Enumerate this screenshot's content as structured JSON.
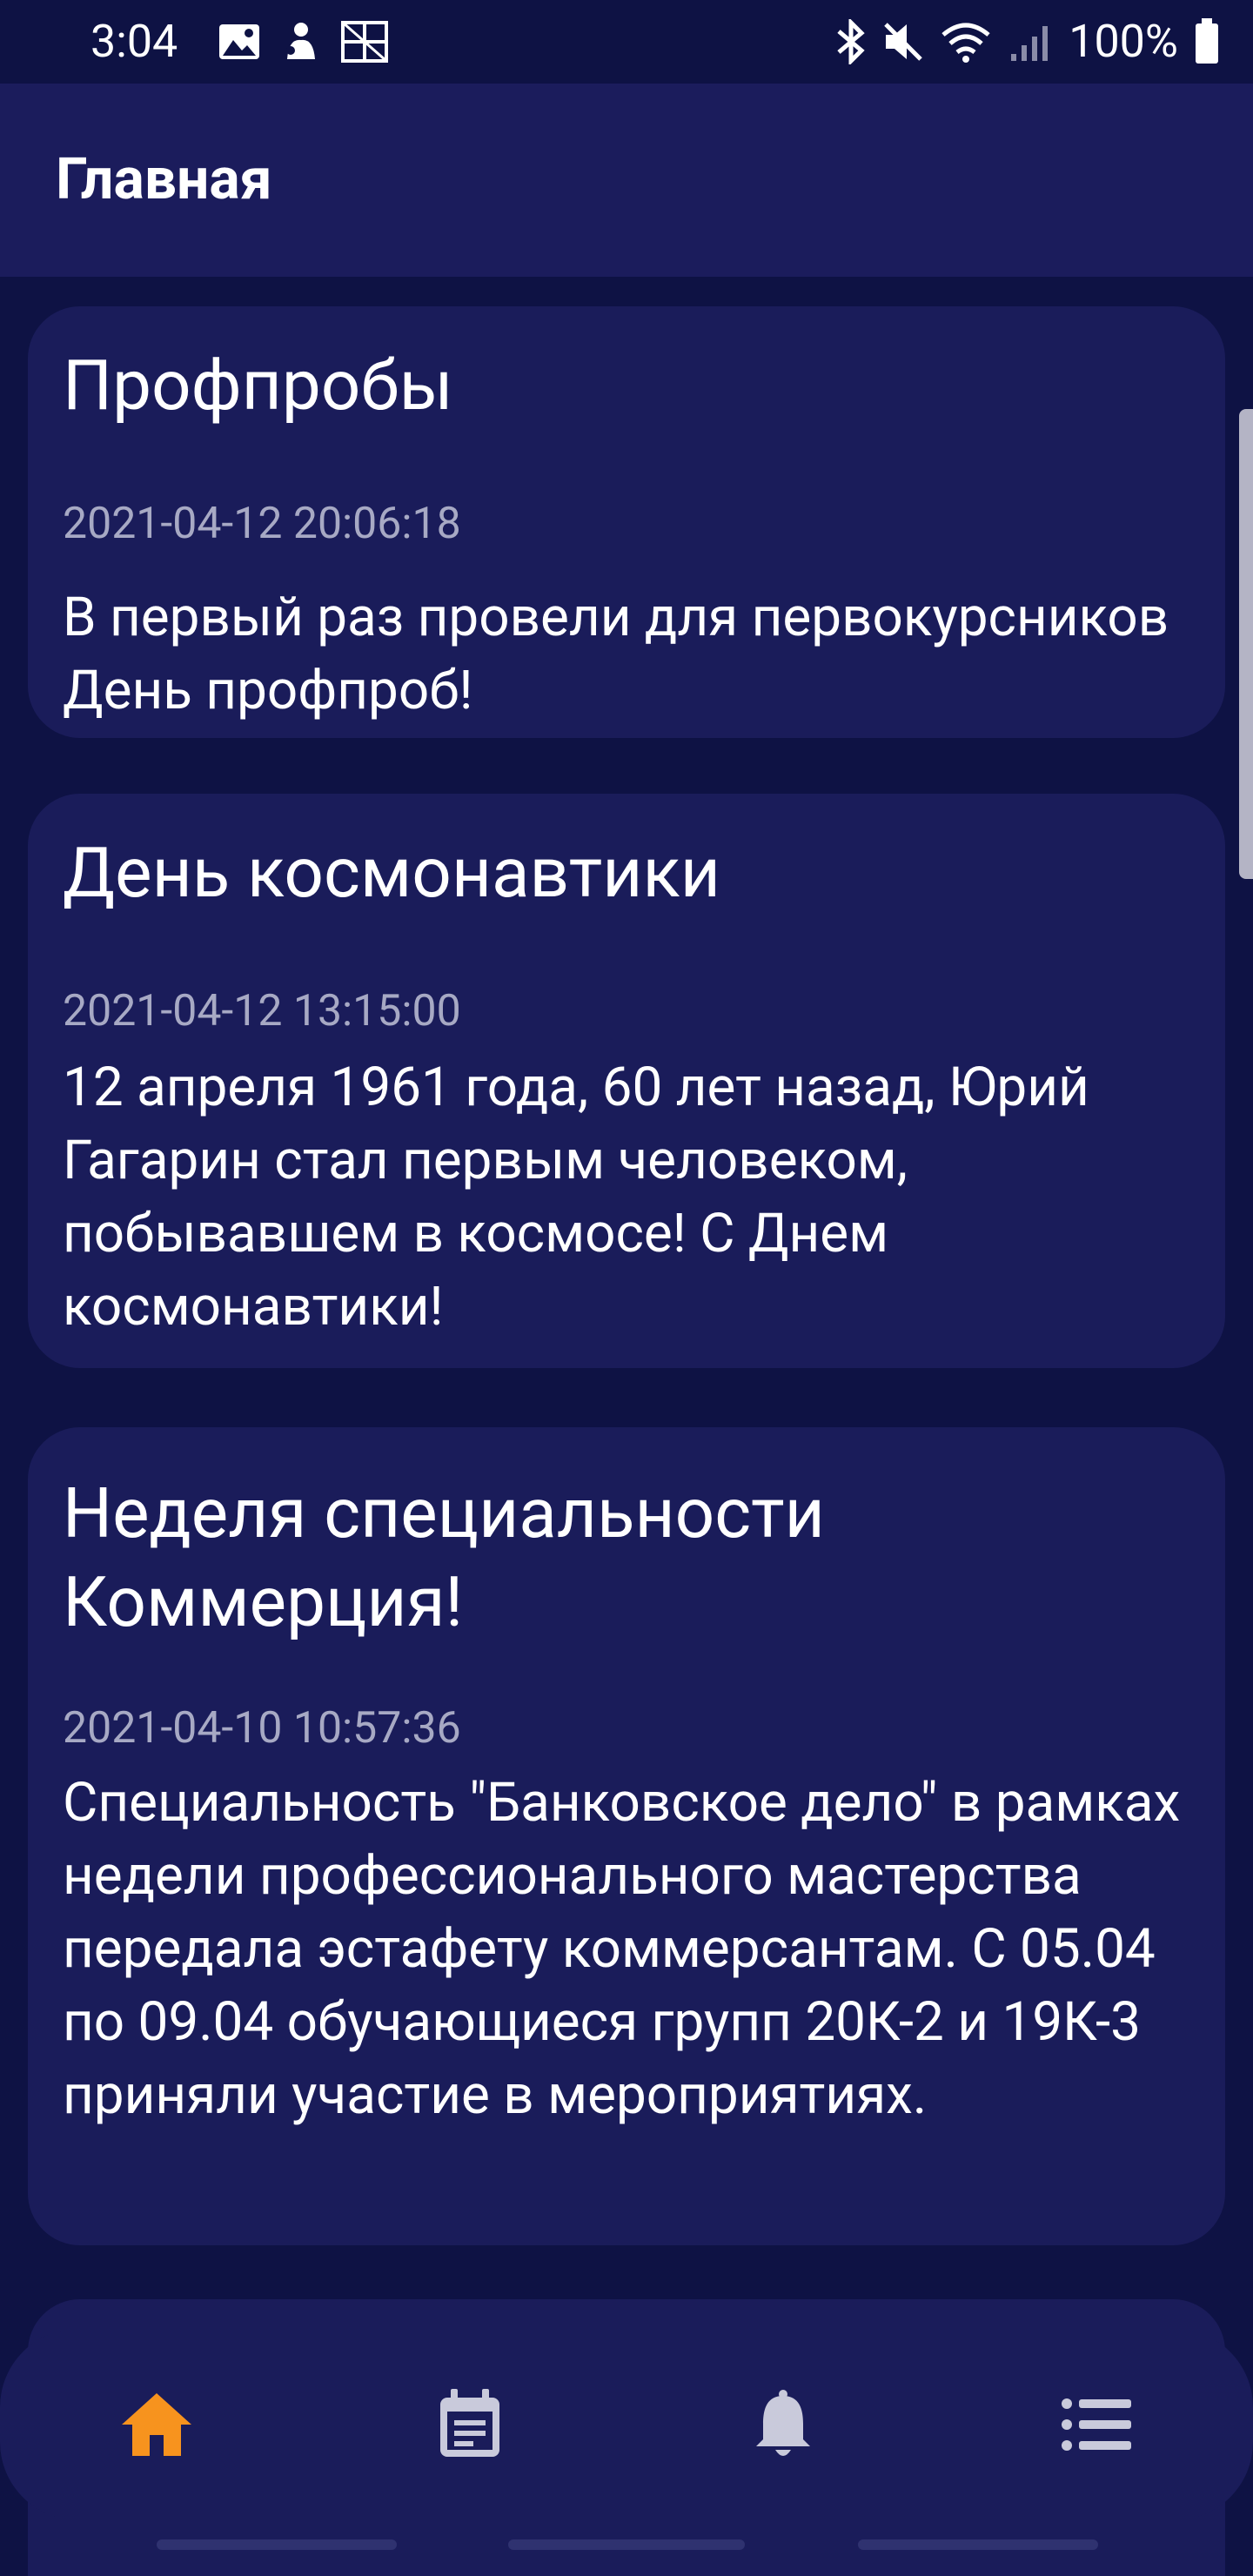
{
  "status_bar": {
    "time": "3:04",
    "battery": "100%"
  },
  "app_bar": {
    "title": "Главная"
  },
  "news": [
    {
      "title": "Профпробы",
      "date": "2021-04-12 20:06:18",
      "body": "В первый раз провели для первокурсников День профпроб!"
    },
    {
      "title": "День космонавтики",
      "date": "2021-04-12 13:15:00",
      "body": "12 апреля 1961 года, 60 лет назад, Юрий Гагарин стал первым человеком, побывавшем в космосе! С Днем космонавтики!"
    },
    {
      "title": "Неделя специальности Коммерция!",
      "date": "2021-04-10 10:57:36",
      "body": "Специальность \"Банковское дело\" в рамках недели профессионального мастерства передала эстафету коммерсантам. С 05.04 по 09.04 обучающиеся групп 20К-2 и 19К-3 приняли участие в мероприятиях."
    }
  ],
  "bottom_nav": {
    "items": [
      {
        "icon": "home-icon",
        "active": true
      },
      {
        "icon": "calendar-icon",
        "active": false
      },
      {
        "icon": "bell-icon",
        "active": false
      },
      {
        "icon": "list-icon",
        "active": false
      }
    ]
  },
  "colors": {
    "background": "#0e1244",
    "app_bar": "#1b1c5c",
    "card": "#1a1c5a",
    "date_text": "#a7a9c4",
    "active_icon": "#f7931e",
    "inactive_icon": "#c9cadb"
  }
}
